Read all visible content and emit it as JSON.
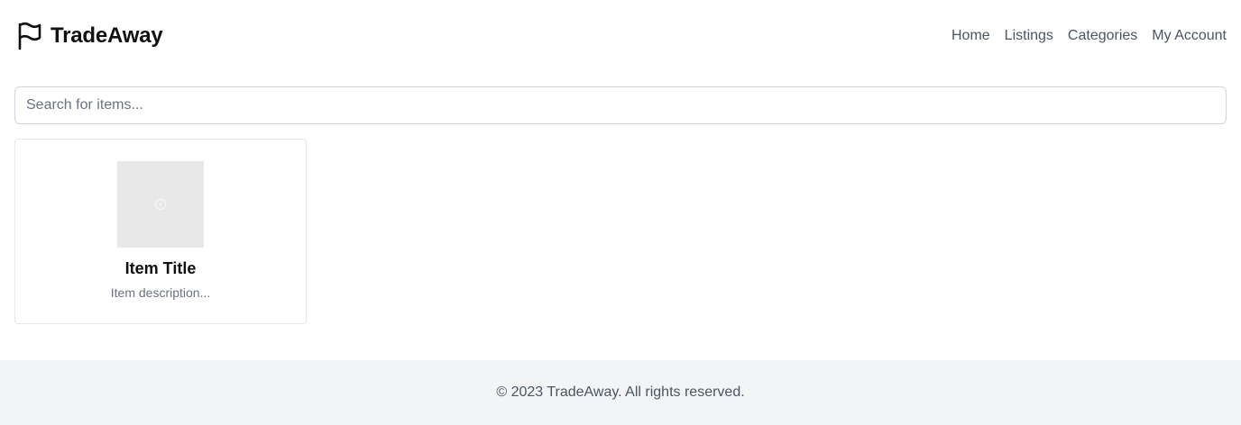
{
  "header": {
    "brand_icon": "flag-icon",
    "brand_name": "TradeAway",
    "nav": [
      {
        "label": "Home"
      },
      {
        "label": "Listings"
      },
      {
        "label": "Categories"
      },
      {
        "label": "My Account"
      }
    ]
  },
  "search": {
    "placeholder": "Search for items...",
    "value": ""
  },
  "listings": [
    {
      "image_icon": "image-placeholder-icon",
      "title": "Item Title",
      "description": "Item description..."
    }
  ],
  "footer": {
    "copyright": "© 2023 TradeAway. All rights reserved."
  },
  "colors": {
    "text_primary": "#111111",
    "text_muted": "#6b7280",
    "nav_text": "#4b5563",
    "border": "#d1d5db",
    "footer_bg": "#f3f4f6",
    "thumb_bg": "#e8e8e8"
  }
}
